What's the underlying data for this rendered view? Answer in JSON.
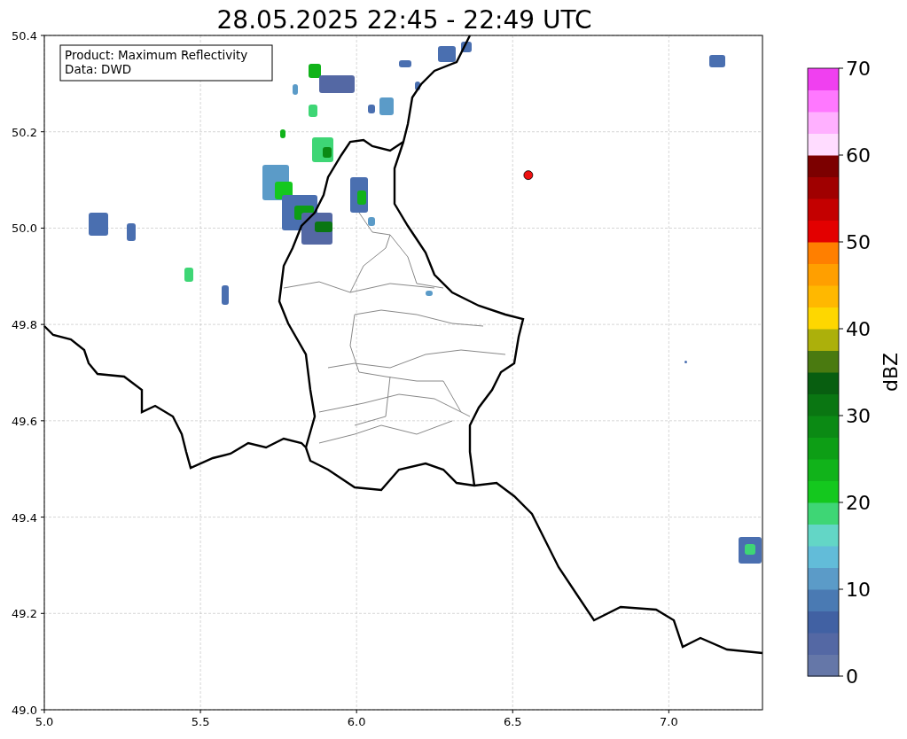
{
  "title": "28.05.2025 22:45 - 22:49 UTC",
  "map": {
    "legend_lines": [
      "Product: Maximum Reflectivity",
      "Data: DWD"
    ],
    "chart_data": {
      "type": "scatter",
      "grid": true,
      "xlim": [
        5.0,
        7.3
      ],
      "ylim": [
        49.0,
        50.4
      ],
      "xticks": [
        {
          "value": 5.0,
          "label": "5.0"
        },
        {
          "value": 5.5,
          "label": "5.5"
        },
        {
          "value": 6.0,
          "label": "6.0"
        },
        {
          "value": 6.5,
          "label": "6.5"
        },
        {
          "value": 7.0,
          "label": "7.0"
        }
      ],
      "yticks": [
        {
          "value": 49.0,
          "label": "49.0"
        },
        {
          "value": 49.2,
          "label": "49.2"
        },
        {
          "value": 49.4,
          "label": "49.4"
        },
        {
          "value": 49.6,
          "label": "49.6"
        },
        {
          "value": 49.8,
          "label": "49.8"
        },
        {
          "value": 50.0,
          "label": "50.0"
        },
        {
          "value": 50.2,
          "label": "50.2"
        },
        {
          "value": 50.4,
          "label": "50.4"
        }
      ],
      "x": [
        6.55
      ],
      "series": [
        {
          "color": "#ee1111",
          "values": [
            50.11
          ]
        }
      ]
    }
  },
  "colorbar": {
    "label": "dBZ",
    "ticks": [
      "70",
      "60",
      "50",
      "40",
      "30",
      "20",
      "10",
      "0"
    ],
    "segments": [
      {
        "color": "#6577a8"
      },
      {
        "color": "#5468a4"
      },
      {
        "color": "#4161a3"
      },
      {
        "color": "#4a7ab3"
      },
      {
        "color": "#5b9bc8"
      },
      {
        "color": "#62bcd9"
      },
      {
        "color": "#63d6c6"
      },
      {
        "color": "#3ed675"
      },
      {
        "color": "#14c81e"
      },
      {
        "color": "#11b31a"
      },
      {
        "color": "#0d9e15"
      },
      {
        "color": "#0b8a14"
      },
      {
        "color": "#0a7612"
      },
      {
        "color": "#085e10"
      },
      {
        "color": "#4a7a10"
      },
      {
        "color": "#acb00b"
      },
      {
        "color": "#fed700"
      },
      {
        "color": "#ffb800"
      },
      {
        "color": "#ff9f00"
      },
      {
        "color": "#ff7f00"
      },
      {
        "color": "#e30000"
      },
      {
        "color": "#c40000"
      },
      {
        "color": "#a00000"
      },
      {
        "color": "#7c0000"
      },
      {
        "color": "#ffdcff"
      },
      {
        "color": "#ffb0ff"
      },
      {
        "color": "#ff78ff"
      },
      {
        "color": "#f040f0"
      }
    ]
  }
}
